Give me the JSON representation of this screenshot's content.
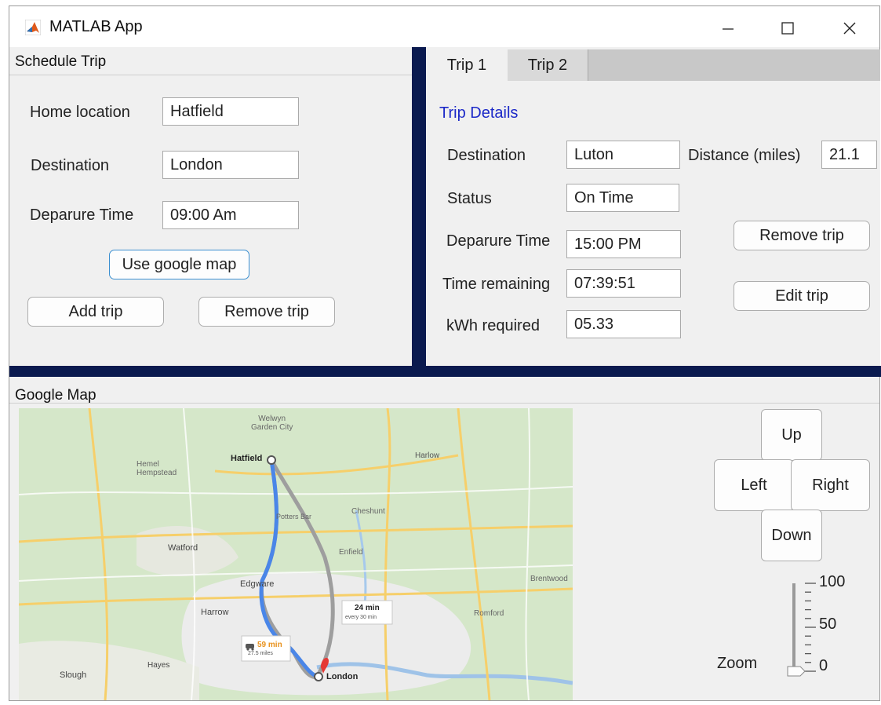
{
  "window": {
    "title": "MATLAB App"
  },
  "schedule": {
    "title": "Schedule Trip",
    "home_label": "Home location",
    "home_value": "Hatfield",
    "destination_label": "Destination",
    "destination_value": "London",
    "departure_label": "Deparure Time",
    "departure_value": "09:00 Am",
    "google_map_button": "Use google map",
    "add_trip_button": "Add trip",
    "remove_trip_button": "Remove trip"
  },
  "tabs": [
    {
      "label": "Trip 1",
      "active": true
    },
    {
      "label": "Trip 2",
      "active": false
    }
  ],
  "trip_details": {
    "title": "Trip Details",
    "destination_label": "Destination",
    "destination_value": "Luton",
    "distance_label": "Distance (miles)",
    "distance_value": "21.1",
    "status_label": "Status",
    "status_value": "On Time",
    "departure_label": "Deparure Time",
    "departure_value": "15:00 PM",
    "remaining_label": "Time remaining",
    "remaining_value": "07:39:51",
    "kwh_label": "kWh required",
    "kwh_value": "05.33",
    "remove_trip_button": "Remove trip",
    "edit_trip_button": "Edit trip"
  },
  "google_map": {
    "title": "Google Map",
    "place_labels": {
      "welwyn": "Welwyn\nGarden City",
      "hatfield": "Hatfield",
      "harlow": "Harlow",
      "hemel": "Hemel\nHempstead",
      "potters_bar": "Potters Bar",
      "cheshunt": "Cheshunt",
      "watford": "Watford",
      "enfield": "Enfield",
      "edgware": "Edgware",
      "harrow": "Harrow",
      "romford": "Romford",
      "london": "London",
      "slough": "Slough",
      "hayes": "Hayes",
      "brentwood": "Brentwood"
    },
    "route_alt_time": "24 min",
    "route_alt_sub": "every 30 min",
    "route_main_time": "59 min",
    "route_main_sub": "27.5 miles",
    "nav": {
      "up": "Up",
      "left": "Left",
      "right": "Right",
      "down": "Down"
    },
    "zoom_label": "Zoom",
    "zoom_ticks": [
      "100",
      "50",
      "0"
    ],
    "zoom_value": 0
  },
  "colors": {
    "dark_divider": "#0a1a4f",
    "trip_details_title": "#1c29c8",
    "route_main": "#4a86e8",
    "route_alt": "#9e9e9e",
    "focus_border": "#3b8fd0"
  }
}
